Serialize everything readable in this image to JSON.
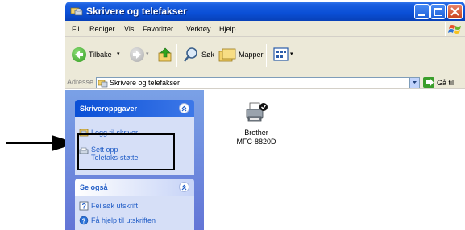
{
  "window": {
    "title": "Skrivere og telefakser"
  },
  "menu": {
    "items": [
      "Fil",
      "Rediger",
      "Vis",
      "Favoritter",
      "Verktøy",
      "Hjelp"
    ]
  },
  "toolbar": {
    "back_label": "Tilbake",
    "search_label": "Søk",
    "folders_label": "Mapper"
  },
  "address": {
    "label": "Adresse",
    "value": "Skrivere og telefakser",
    "go_label": "Gå til"
  },
  "taskpane": {
    "printer_tasks": {
      "title": "Skriveroppgaver",
      "items": [
        "Legg til skriver",
        "Sett opp",
        "Telefaks-støtte"
      ]
    },
    "see_also": {
      "title": "Se også",
      "items": [
        "Feilsøk utskrift",
        "Få hjelp til utskriften"
      ]
    }
  },
  "content": {
    "printer": {
      "name_line1": "Brother",
      "name_line2": "MFC-8820D"
    }
  },
  "colors": {
    "titlebar": "#0a4fd6",
    "taskpane": "#7aa1e6",
    "link": "#215dc6"
  }
}
